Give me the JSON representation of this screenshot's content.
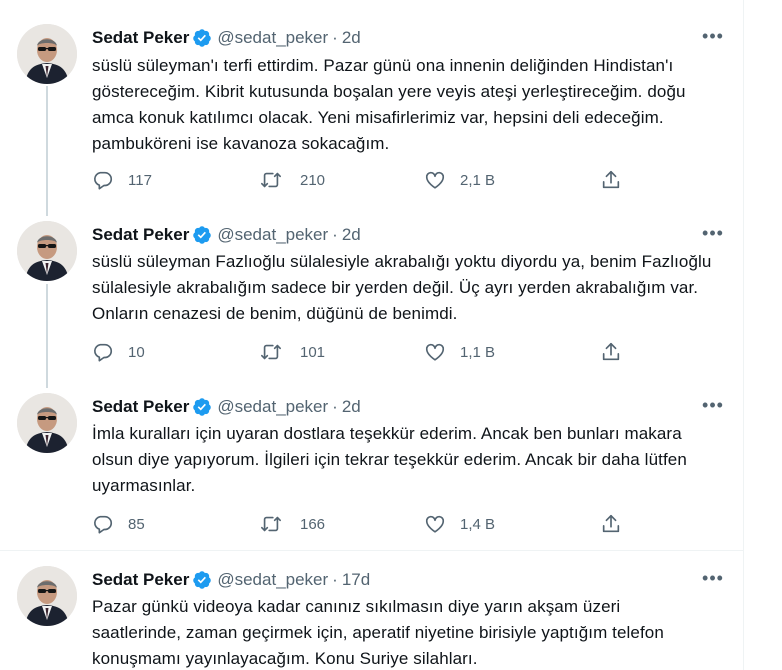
{
  "tweets": [
    {
      "name": "Sedat Peker",
      "handle": "@sedat_peker",
      "time": "2d",
      "text": "süslü süleyman'ı terfi ettirdim. Pazar günü ona innenin deliğinden Hindistan'ı göstereceğim. Kibrit kutusunda boşalan yere veyis ateşi yerleştireceğim. doğu amca konuk katılımcı olacak. Yeni misafirlerimiz var, hepsini deli edeceğim. pambuköreni ise kavanoza sokacağım.",
      "replies": "117",
      "retweets": "210",
      "likes": "2,1 B"
    },
    {
      "name": "Sedat Peker",
      "handle": "@sedat_peker",
      "time": "2d",
      "text": "süslü süleyman Fazlıoğlu sülalesiyle akrabalığı yoktu diyordu ya, benim Fazlıoğlu sülalesiyle akrabalığım sadece bir yerden değil. Üç ayrı yerden akrabalığım var. Onların cenazesi de benim, düğünü de benimdi.",
      "replies": "10",
      "retweets": "101",
      "likes": "1,1 B"
    },
    {
      "name": "Sedat Peker",
      "handle": "@sedat_peker",
      "time": "2d",
      "text": "İmla kuralları için uyaran dostlara teşekkür ederim. Ancak ben bunları makara olsun diye yapıyorum. İlgileri için tekrar teşekkür ederim. Ancak bir daha lütfen uyarmasınlar.",
      "replies": "85",
      "retweets": "166",
      "likes": "1,4 B"
    },
    {
      "name": "Sedat Peker",
      "handle": "@sedat_peker",
      "time": "17d",
      "text": "Pazar günkü videoya kadar canınız sıkılmasın diye yarın akşam üzeri saatlerinde, zaman geçirmek için,  aperatif niyetine birisiyle yaptığım telefon konuşmamı yayınlayacağım. Konu Suriye silahları."
    }
  ],
  "ui": {
    "dot": "·",
    "more": "•••",
    "icons": {
      "verified": "verified-badge-icon",
      "reply": "reply-icon",
      "retweet": "retweet-icon",
      "like": "heart-icon",
      "share": "share-icon",
      "more": "more-options-icon"
    },
    "colors": {
      "verified": "#1d9bf0",
      "text": "#0f1419",
      "secondary": "#536471",
      "thread_line": "#cfd9de",
      "divider": "#eff3f4"
    }
  }
}
